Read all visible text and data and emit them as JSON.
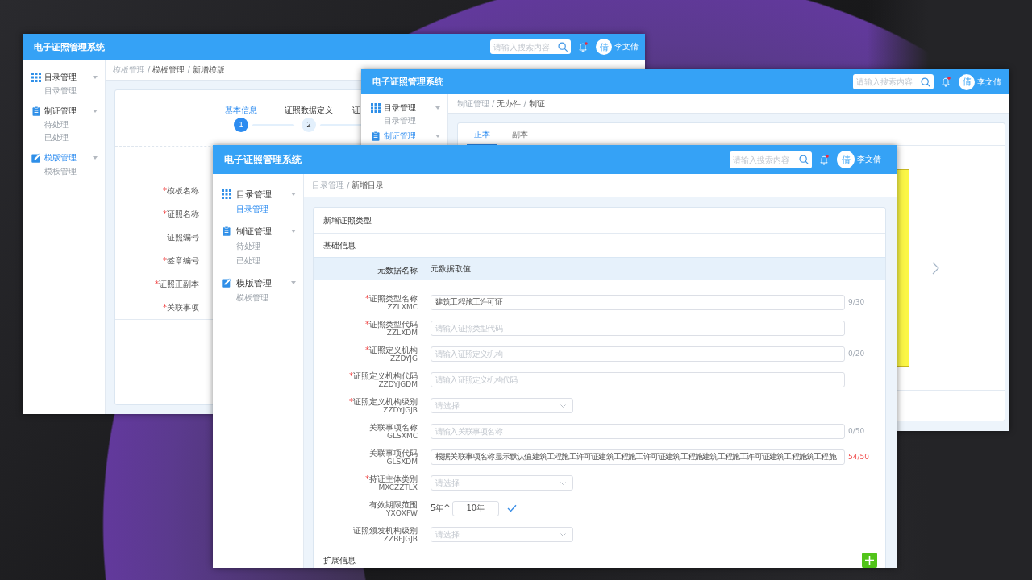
{
  "windows": [
    {
      "kind": "template_form",
      "title": "电子证照管理系统",
      "search": {
        "placeholder": "请输入搜索内容"
      },
      "user": {
        "avatar": "倩",
        "name": "李文倩"
      },
      "sidebar": [
        {
          "label": "目录管理",
          "selected": false,
          "children": [
            {
              "label": "目录管理",
              "selected": false
            }
          ]
        },
        {
          "label": "制证管理",
          "selected": false,
          "children": [
            {
              "label": "待处理",
              "selected": false
            },
            {
              "label": "已处理",
              "selected": false
            }
          ]
        },
        {
          "label": "模版管理",
          "selected": true,
          "children": [
            {
              "label": "模板管理",
              "selected": false
            }
          ]
        }
      ],
      "breadcrumb": [
        {
          "label": "模板管理",
          "dimmed": true
        },
        {
          "separator": "/",
          "label": "模板管理",
          "dimmed": false
        },
        {
          "separator": "/",
          "label": "新增模版",
          "dimmed": false
        }
      ],
      "steps": [
        {
          "label": "基本信息",
          "number": "1",
          "selected": true
        },
        {
          "label": "证照数据定义",
          "number": "2",
          "selected": false
        },
        {
          "label": "证",
          "selected": false
        }
      ],
      "fields": [
        {
          "asterisk": "*",
          "label": "模板名称"
        },
        {
          "asterisk": "*",
          "label": "证照名称"
        },
        {
          "label": "证照编号"
        },
        {
          "asterisk": "*",
          "label": "签章编号"
        },
        {
          "asterisk": "*",
          "label": "证照正副本"
        },
        {
          "asterisk": "*",
          "label": "关联事项"
        }
      ]
    },
    {
      "kind": "certificate_view",
      "title": "电子证照管理系统",
      "search": {
        "placeholder": "请输入搜索内容"
      },
      "user": {
        "avatar": "倩",
        "name": "李文倩"
      },
      "sidebar": [
        {
          "label": "目录管理",
          "selected": false,
          "children": [
            {
              "label": "目录管理",
              "selected": false
            }
          ]
        },
        {
          "label": "制证管理",
          "selected": true
        }
      ],
      "breadcrumb": [
        {
          "label": "制证管理",
          "dimmed": true
        },
        {
          "separator": "/",
          "label": "无办件",
          "dimmed": false
        },
        {
          "separator": "/",
          "label": "制证",
          "dimmed": false
        }
      ],
      "tabs": [
        {
          "label": "正本",
          "selected": true
        },
        {
          "label": "副本",
          "selected": false
        }
      ]
    },
    {
      "kind": "catalog_form",
      "title": "电子证照管理系统",
      "search": {
        "placeholder": "请输入搜索内容"
      },
      "user": {
        "avatar": "倩",
        "name": "李文倩"
      },
      "sidebar": [
        {
          "label": "目录管理",
          "selected": false,
          "children": [
            {
              "label": "目录管理",
              "selected": true
            }
          ]
        },
        {
          "label": "制证管理",
          "selected": false,
          "children": [
            {
              "label": "待处理",
              "selected": false
            },
            {
              "label": "已处理",
              "selected": false
            }
          ]
        },
        {
          "label": "模版管理",
          "selected": false,
          "children": [
            {
              "label": "模板管理",
              "selected": false
            }
          ]
        }
      ],
      "breadcrumb": [
        {
          "label": "目录管理",
          "dimmed": true
        },
        {
          "separator": "/",
          "label": "新增目录",
          "dimmed": false
        }
      ],
      "card_title": "新增证照类型",
      "basic_section": {
        "title": "基础信息",
        "columns": [
          "元数据名称",
          "元数据取值"
        ],
        "fields": [
          {
            "kind": "text",
            "asterisk": "*",
            "label": "证照类型名称",
            "code": "ZZLXMC",
            "value": "建筑工程施工许可证",
            "counter": {
              "text": "9/30",
              "error": false
            }
          },
          {
            "kind": "text",
            "asterisk": "*",
            "label": "证照类型代码",
            "code": "ZZLXDM",
            "placeholder": "请输入证照类型代码"
          },
          {
            "kind": "text",
            "asterisk": "*",
            "label": "证照定义机构",
            "code": "ZZDYJG",
            "placeholder": "请输入证照定义机构",
            "counter": {
              "text": "0/20",
              "error": false
            }
          },
          {
            "kind": "text",
            "asterisk": "*",
            "label": "证照定义机构代码",
            "code": "ZZDYJGDM",
            "placeholder": "请输入证照定义机构代码"
          },
          {
            "kind": "select",
            "asterisk": "*",
            "label": "证照定义机构级别",
            "code": "ZZDYJGJB",
            "placeholder": "请选择"
          },
          {
            "kind": "text",
            "label": "关联事项名称",
            "code": "GLSXMC",
            "placeholder": "请输入关联事项名称",
            "counter": {
              "text": "0/50",
              "error": false
            }
          },
          {
            "kind": "text",
            "label": "关联事项代码",
            "code": "GLSXDM",
            "value": "根据关联事项名称显示默认值建筑工程施工许可证建筑工程施工许可证建筑工程施建筑工程施工许可证建筑工程施筑工程施",
            "counter": {
              "text": "54/50",
              "error": true
            }
          },
          {
            "kind": "select",
            "asterisk": "*",
            "label": "持证主体类别",
            "code": "MXCZZTLX",
            "placeholder": "请选择"
          },
          {
            "kind": "range",
            "label": "有效期限范围",
            "code": "YXQXFW",
            "start": "5年^",
            "end": "10年"
          },
          {
            "kind": "select",
            "label": "证照颁发机构级别",
            "code": "ZZBFJGJB",
            "placeholder": "请选择"
          }
        ]
      },
      "extension_section": {
        "title": "扩展信息"
      }
    }
  ]
}
